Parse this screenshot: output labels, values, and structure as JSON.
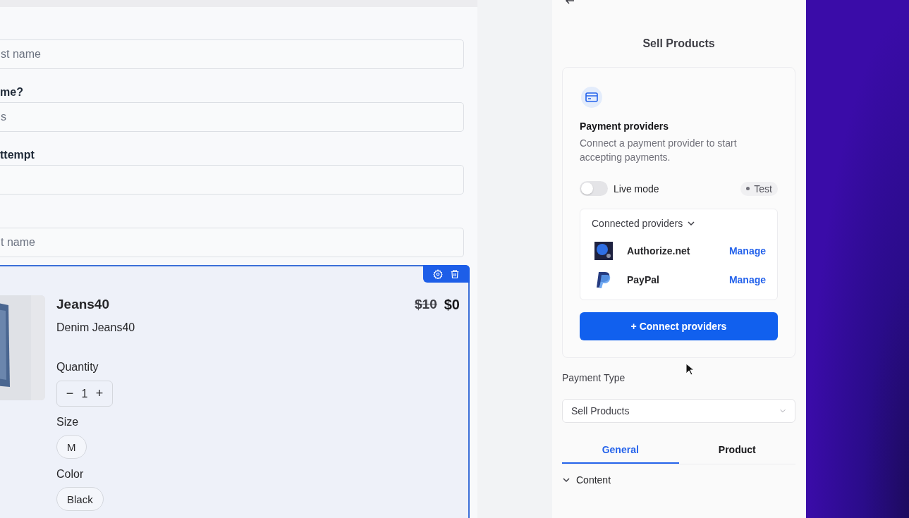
{
  "form": {
    "fields": [
      {
        "placeholder": "st name"
      },
      {
        "label": "me?",
        "placeholder": "s"
      },
      {
        "label": "ttempt"
      },
      {
        "placeholder": "t name"
      }
    ]
  },
  "product": {
    "selected": true,
    "name": "Jeans40",
    "description": "Denim Jeans40",
    "old_price": "$10",
    "price": "$0",
    "quantity": {
      "label": "Quantity",
      "minus": "−",
      "value": "1",
      "plus": "+"
    },
    "options": [
      {
        "label": "Size",
        "choices": [
          {
            "label": "M"
          }
        ]
      },
      {
        "label": "Color",
        "choices": [
          {
            "label": "Black"
          }
        ]
      }
    ]
  },
  "panel": {
    "title": "Sell Products",
    "payment_card": {
      "title": "Payment providers",
      "description": "Connect a payment provider to start accepting payments.",
      "live_mode": {
        "label": "Live mode",
        "on": false
      },
      "mode_badge": "Test",
      "connected": {
        "title": "Connected providers",
        "expanded": true,
        "providers": [
          {
            "kind": "authorize",
            "name": "Authorize.net",
            "action": "Manage"
          },
          {
            "kind": "paypal",
            "name": "PayPal",
            "action": "Manage"
          }
        ]
      },
      "connect_button": "+ Connect providers"
    },
    "payment_type": {
      "label": "Payment Type",
      "value": "Sell Products"
    },
    "tabs": [
      {
        "label": "General",
        "selected": true
      },
      {
        "label": "Product",
        "selected": false
      }
    ],
    "section": {
      "label": "Content",
      "expanded": true
    }
  }
}
